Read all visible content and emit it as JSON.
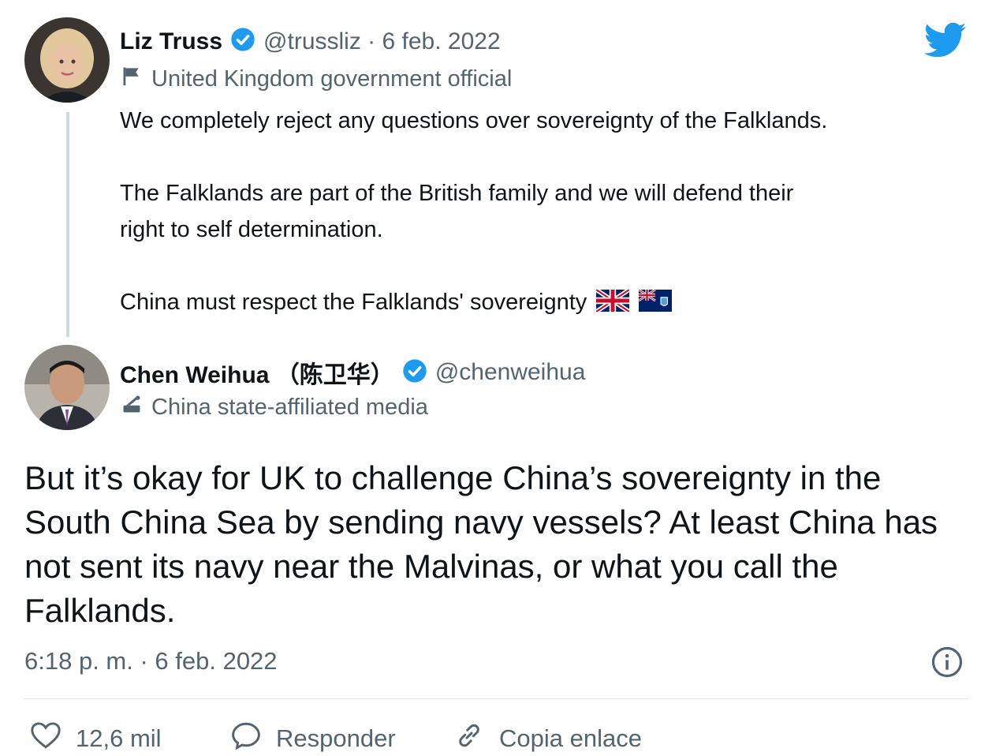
{
  "quoted_tweet": {
    "author_name": "Liz Truss",
    "handle_date": "@trussliz · 6 feb. 2022",
    "label": "United Kingdom government official",
    "lines": [
      "We completely reject any questions over sovereignty of the Falklands.",
      "The Falklands are part of the British family and we will defend their",
      "right to self determination.",
      "China must respect the Falklands' sovereignty"
    ]
  },
  "reply_tweet": {
    "author_name": "Chen Weihua （陈卫华）",
    "handle": "@chenweihua",
    "label": "China state-affiliated media",
    "text": "But it’s okay for UK to challenge China’s sovereignty in the South China Sea by sending navy vessels? At least China has not sent its navy near the Malvinas, or what you call the Falklands.",
    "timestamp": "6:18 p. m. · 6 feb. 2022"
  },
  "actions": {
    "likes": "12,6 mil",
    "reply": "Responder",
    "copy_link": "Copia enlace"
  },
  "icons": {
    "brand": "twitter-bird-icon",
    "verified": "verified-badge-icon",
    "flag": "flag-icon",
    "media": "state-media-icon",
    "info": "info-icon",
    "heart": "heart-icon",
    "reply": "reply-icon",
    "link": "link-icon"
  },
  "colors": {
    "twitter_blue": "#1d9bf0",
    "secondary_text": "#536471",
    "primary_text": "#0f1419"
  }
}
